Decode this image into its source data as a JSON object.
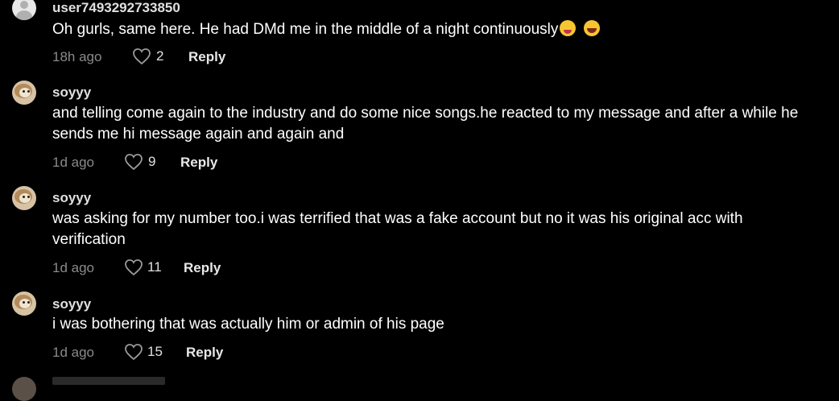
{
  "comments": [
    {
      "username": "user7493292733850",
      "text": "Oh gurls, same here. He had DMd me in the middle of a night continuously",
      "emojis": [
        "zany-face",
        "grinning-squinting-face"
      ],
      "time": "18h ago",
      "likes": "2",
      "reply_label": "Reply"
    },
    {
      "username": "soyyy",
      "text": "and telling come again to the industry and do some nice songs.he reacted to my message and after a while he sends me hi message again and again and",
      "time": "1d ago",
      "likes": "9",
      "reply_label": "Reply"
    },
    {
      "username": "soyyy",
      "text": "was asking for my number too.i was terrified that was a fake account but no it was his original acc with verification",
      "time": "1d ago",
      "likes": "11",
      "reply_label": "Reply"
    },
    {
      "username": "soyyy",
      "text": "i was bothering that was actually him or admin of his page",
      "time": "1d ago",
      "likes": "15",
      "reply_label": "Reply"
    }
  ],
  "colors": {
    "background": "#000000",
    "text": "#ffffff",
    "meta": "#8a8a8a"
  },
  "icons": [
    "heart-icon",
    "avatar-default-icon"
  ]
}
